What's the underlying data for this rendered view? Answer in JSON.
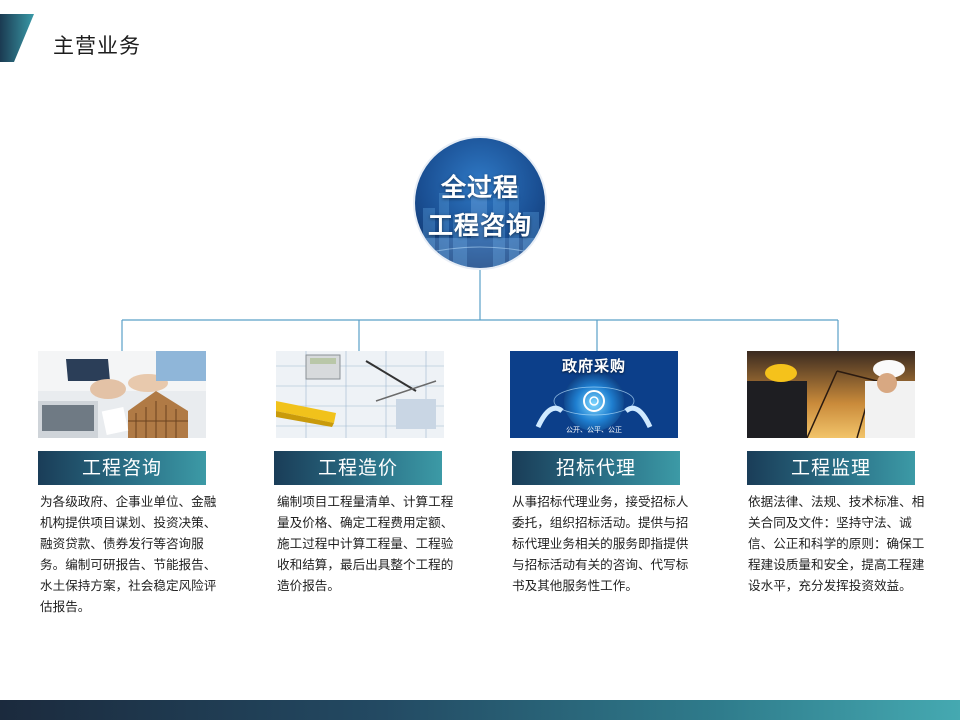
{
  "page": {
    "title": "主营业务"
  },
  "center": {
    "line1": "全过程",
    "line2": "工程咨询"
  },
  "cards": [
    {
      "label": "工程咨询",
      "image": "business-documents-house-photo",
      "desc": "为各级政府、企事业单位、金融机构提供项目谋划、投资决策、融资贷款、债券发行等咨询服务。编制可研报告、节能报告、水土保持方案，社会稳定风险评估报告。"
    },
    {
      "label": "工程造价",
      "image": "blueprint-calculator-level-photo",
      "desc": "编制项目工程量清单、计算工程量及价格、确定工程费用定额、施工过程中计算工程量、工程验收和结算，最后出具整个工程的造价报告。"
    },
    {
      "label": "招标代理",
      "image": "government-procurement-globe-photo",
      "desc": "从事招标代理业务，接受招标人委托，组织招标活动。提供与招标代理业务相关的服务即指提供与招标活动有关的咨询、代写标书及其他服务性工作。",
      "image_caption": "政府采购",
      "image_subcaption": "公开、公平、公正"
    },
    {
      "label": "工程监理",
      "image": "construction-engineers-hardhat-photo",
      "desc": "依据法律、法规、技术标准、相关合同及文件：坚持守法、诚信、公正和科学的原则：确保工程建设质量和安全，提高工程建设水平，充分发挥投资效益。"
    }
  ],
  "colors": {
    "accent_teal": "#2a6f86",
    "connector": "#5aa0c8",
    "center_blue": "#1a4f93"
  }
}
